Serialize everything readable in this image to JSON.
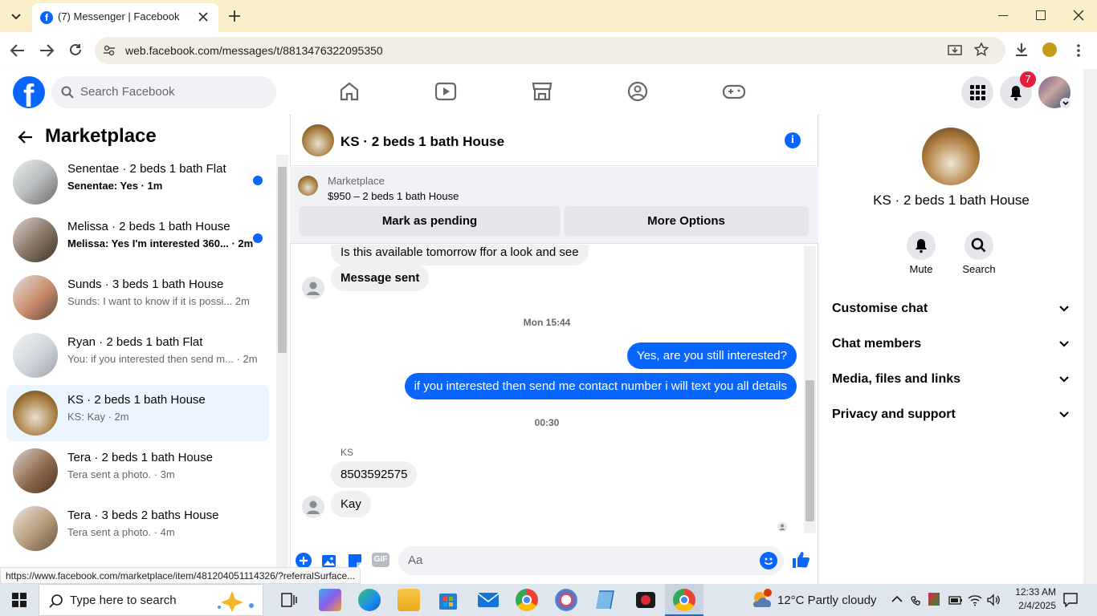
{
  "browser": {
    "tab_title": "(7) Messenger | Facebook",
    "url": "web.facebook.com/messages/t/8813476322095350",
    "status_url": "https://www.facebook.com/marketplace/item/481204051114326/?referralSurface..."
  },
  "fb": {
    "search_placeholder": "Search Facebook",
    "notif_count": "7"
  },
  "left": {
    "title": "Marketplace",
    "items": [
      {
        "title": "Senentae · 2 beds 1 bath Flat",
        "sub": "Senentae: Yes · 1m",
        "unread": true
      },
      {
        "title": "Melissa · 2 beds 1 bath House",
        "sub": "Melissa: Yes I'm interested 360... · 2m",
        "unread": true
      },
      {
        "title": "Sunds · 3 beds 1 bath House",
        "sub": "Sunds: I want to know if it is possi...  2m",
        "unread": false
      },
      {
        "title": "Ryan · 2 beds 1 bath Flat",
        "sub": "You: if you interested then send m... · 2m",
        "unread": false
      },
      {
        "title": "KS · 2 beds 1 bath House",
        "sub": "KS: Kay · 2m",
        "unread": false
      },
      {
        "title": "Tera · 2 beds 1 bath House",
        "sub": "Tera sent a photo. · 3m",
        "unread": false
      },
      {
        "title": "Tera · 3 beds 2 baths House",
        "sub": "Tera sent a photo. · 4m",
        "unread": false
      }
    ]
  },
  "chat": {
    "title": "KS · 2 beds 1 bath House",
    "banner_label": "Marketplace",
    "banner_price": "$950 – 2 beds 1 bath House",
    "btn_pending": "Mark as pending",
    "btn_more": "More Options",
    "msg_cut": "Is this available tomorrow ffor a look and see",
    "msg_sent": "Message sent",
    "ts1": "Mon 15:44",
    "out1": "Yes, are you still interested?",
    "out2": "if you interested then send me contact number i will text you all details",
    "ts2": "00:30",
    "sender": "KS",
    "in1": "8503592575",
    "in2": "Kay",
    "composer_placeholder": "Aa"
  },
  "right": {
    "title": "KS · 2 beds 1 bath House",
    "mute": "Mute",
    "search": "Search",
    "sections": [
      "Customise chat",
      "Chat members",
      "Media, files and links",
      "Privacy and support"
    ]
  },
  "taskbar": {
    "search": "Type here to search",
    "weather": "12°C  Partly cloudy",
    "time": "12:33 AM",
    "date": "2/4/2025"
  }
}
